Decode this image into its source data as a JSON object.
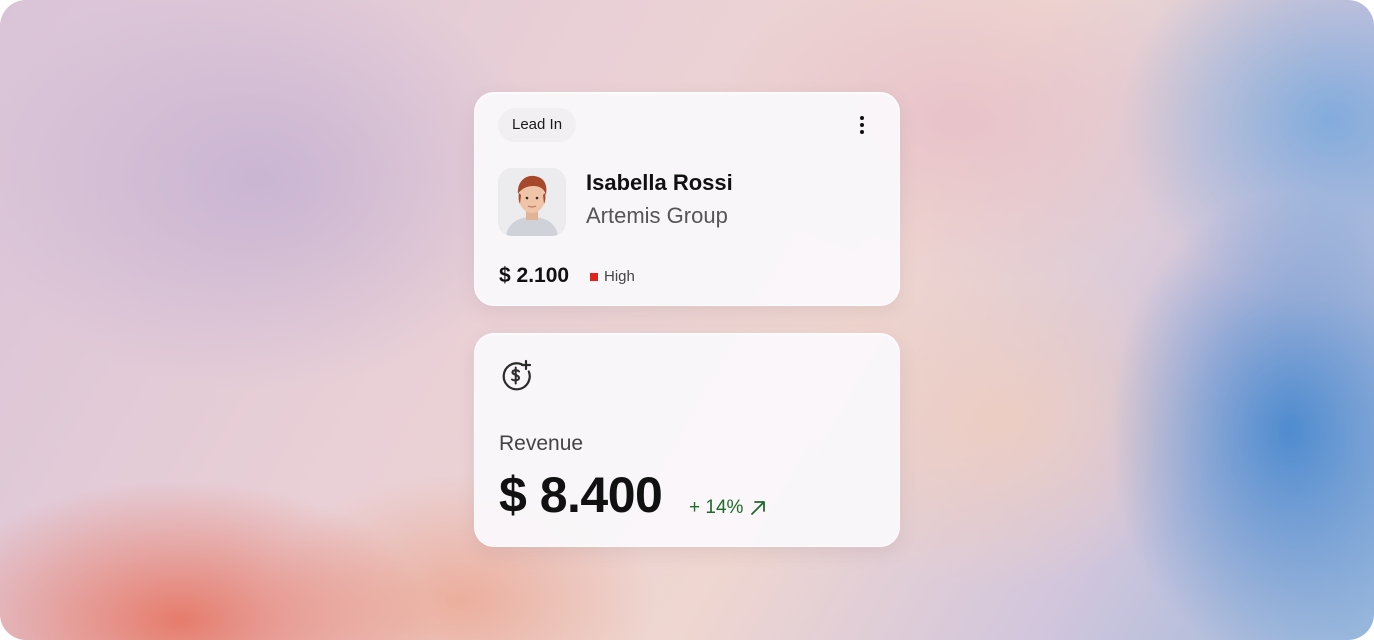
{
  "lead_card": {
    "stage": "Lead In",
    "name": "Isabella Rossi",
    "company": "Artemis Group",
    "amount": "$ 2.100",
    "priority": "High",
    "priority_color": "#e0231b"
  },
  "revenue_card": {
    "icon": "dollar-plus-icon",
    "label": "Revenue",
    "value": "$ 8.400",
    "change": "+ 14%",
    "change_color": "#1f6b2b"
  }
}
